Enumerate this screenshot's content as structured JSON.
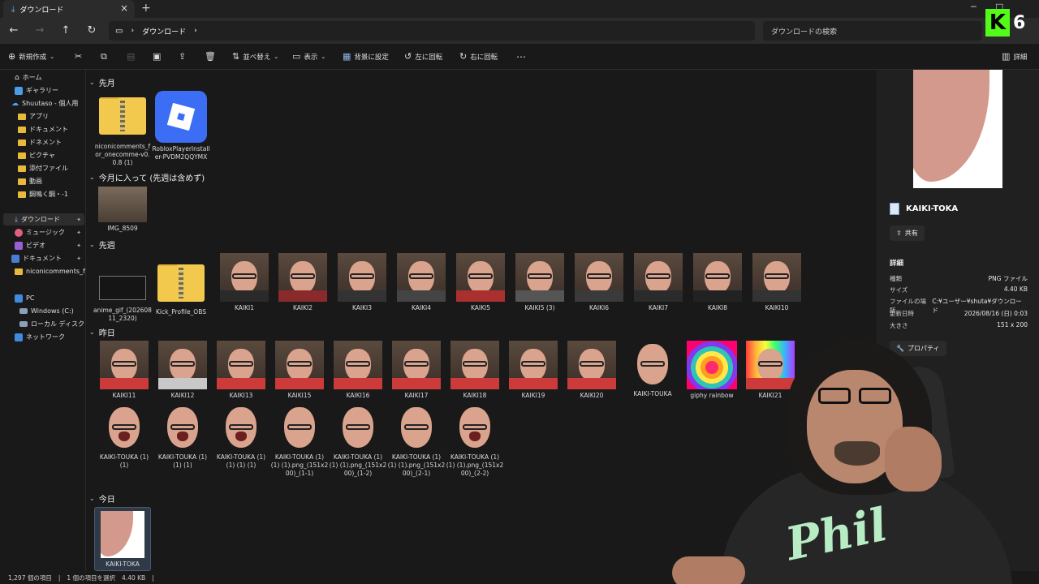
{
  "window": {
    "tab_title": "ダウンロード",
    "minimize": "─",
    "maximize": "□"
  },
  "address": {
    "breadcrumb_root": "ダウンロード",
    "search_placeholder": "ダウンロードの検索"
  },
  "stream_badge": {
    "letter": "K",
    "count": "6"
  },
  "toolbar": {
    "new": "新規作成",
    "sort": "並べ替え",
    "view": "表示",
    "set_background": "背景に設定",
    "rotate_left": "左に回転",
    "rotate_right": "右に回転",
    "more": "…",
    "details": "詳細"
  },
  "sidebar": {
    "items": [
      {
        "label": "ホーム"
      },
      {
        "label": "ギャラリー"
      },
      {
        "label": "Shuutaso - 個人用"
      },
      {
        "label": "アプリ"
      },
      {
        "label": "ドキュメント"
      },
      {
        "label": "ドネメント"
      },
      {
        "label": "ピクチャ"
      },
      {
        "label": "添付ファイル"
      },
      {
        "label": "動画"
      },
      {
        "label": "鋼鳴く鋼・-1"
      },
      {
        "label": "ダウンロード"
      },
      {
        "label": "ミュージック"
      },
      {
        "label": "ビデオ"
      },
      {
        "label": "ドキュメント"
      },
      {
        "label": "niconicomments_for"
      },
      {
        "label": "PC"
      },
      {
        "label": "Windows (C:)"
      },
      {
        "label": "ローカル ディスク (D:)"
      },
      {
        "label": "ネットワーク"
      }
    ]
  },
  "groups": {
    "last_month": "先月",
    "this_month": "今月に入って (先週は含めず)",
    "last_week": "先週",
    "yesterday": "昨日",
    "today": "今日"
  },
  "files": {
    "last_month": [
      {
        "name": "niconicomments_for_onecomme-v0.0.8 (1)"
      },
      {
        "name": "RobloxPlayerInstaller-PVDM2QQYMX"
      }
    ],
    "this_month": [
      {
        "name": "IMG_8509"
      }
    ],
    "last_week": [
      {
        "name": "anime_gif_(20260811_2320)"
      },
      {
        "name": "Kick_Profile_OBS"
      },
      {
        "name": "KAIKI1"
      },
      {
        "name": "KAIKI2"
      },
      {
        "name": "KAIKI3"
      },
      {
        "name": "KAIKI4"
      },
      {
        "name": "KAIKI5"
      },
      {
        "name": "KAIKI5 (3)"
      },
      {
        "name": "KAIKI6"
      },
      {
        "name": "KAIKI7"
      },
      {
        "name": "KAIKI8"
      },
      {
        "name": "KAIKI10"
      }
    ],
    "yesterday_row1": [
      {
        "name": "KAIKI11"
      },
      {
        "name": "KAIKI12"
      },
      {
        "name": "KAIKI13"
      },
      {
        "name": "KAIKI15"
      },
      {
        "name": "KAIKI16"
      },
      {
        "name": "KAIKI17"
      },
      {
        "name": "KAIKI18"
      },
      {
        "name": "KAIKI19"
      },
      {
        "name": "KAIKI20"
      },
      {
        "name": "KAIKI-TOUKA"
      },
      {
        "name": "giphy rainbow"
      },
      {
        "name": "KAIKI21"
      }
    ],
    "yesterday_row2": [
      {
        "name": "KAIKI-TOUKA (1) (1)"
      },
      {
        "name": "KAIKI-TOUKA (1) (1) (1)"
      },
      {
        "name": "KAIKI-TOUKA (1) (1) (1) (1)"
      },
      {
        "name": "KAIKI-TOUKA (1) (1) (1).png_(151x200)_(1-1)"
      },
      {
        "name": "KAIKI-TOUKA (1) (1) (1).png_(151x200)_(1-2)"
      },
      {
        "name": "KAIKI-TOUKA (1) (1) (1).png_(151x200)_(2-1)"
      },
      {
        "name": "KAIKI-TOUKA (1) (1) (1).png_(151x200)_(2-2)"
      }
    ],
    "today": [
      {
        "name": "KAIKI-TOKA"
      }
    ]
  },
  "details_pane": {
    "file_name": "KAIKI-TOKA",
    "share_button": "共有",
    "section_title": "詳細",
    "rows": [
      {
        "key": "種類",
        "value": "PNG ファイル"
      },
      {
        "key": "サイズ",
        "value": "4.40 KB"
      },
      {
        "key": "ファイルの場所",
        "value": "C:¥ユーザー¥shuta¥ダウンロード"
      },
      {
        "key": "更新日時",
        "value": "2026/08/16 (日) 0:03"
      },
      {
        "key": "大きさ",
        "value": "151 x 200"
      }
    ],
    "properties_button": "プロパティ"
  },
  "status": {
    "item_count": "1,297 個の項目",
    "selected": "1 個の項目を選択",
    "size": "4.40 KB"
  },
  "webcam": {
    "shirt_logo": "Phil"
  }
}
